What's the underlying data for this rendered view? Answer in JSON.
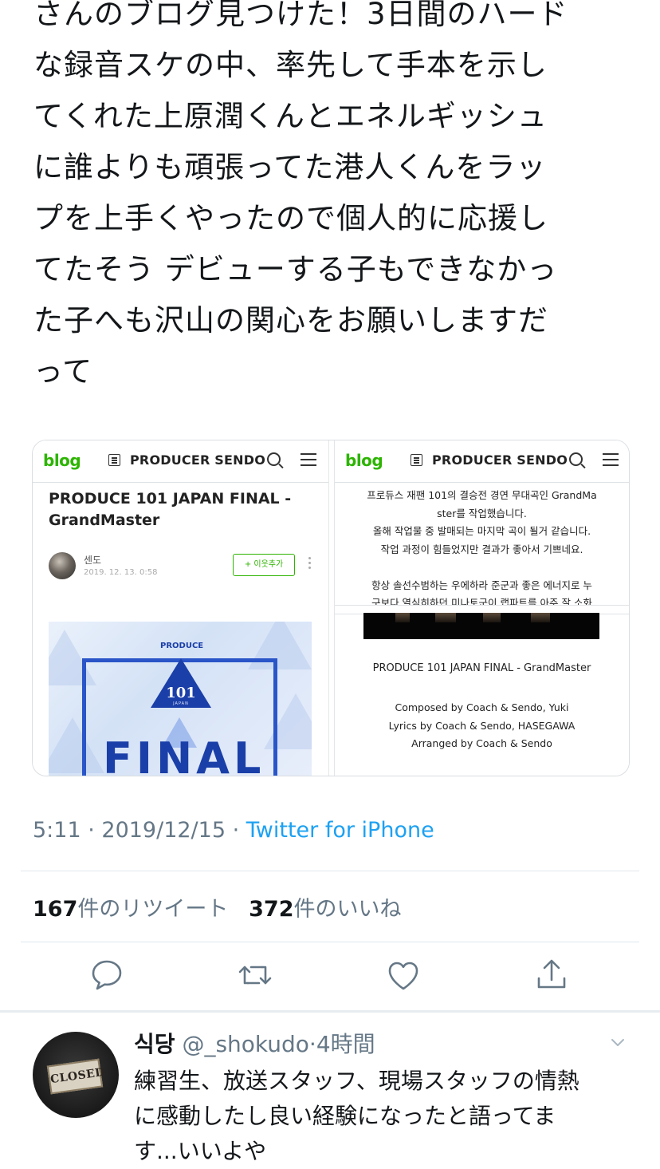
{
  "tweet": {
    "text_lines": [
      "さんのブログ見つけた！3日間のハード",
      "な録音スケの中、率先して手本を示し",
      "てくれた上原潤くんとエネルギッシュ",
      "に誰よりも頑張ってた港人くんをラッ",
      "プを上手くやったので個人的に応援し",
      "てたそう デビューする子もできなかっ",
      "た子へも沢山の関心をお願いしますだ",
      "って"
    ],
    "time": "5:11",
    "date": "2019/12/15",
    "separator": " · ",
    "source": "Twitter for iPhone",
    "retweet_count": "167",
    "retweet_label": "件のリツイート",
    "like_count": "372",
    "like_label": "件のいいね"
  },
  "media_left": {
    "logo": "blog",
    "blog_name": "PRODUCER SENDO",
    "post_title": "PRODUCE 101 JAPAN FINAL - GrandMaster",
    "author": "센도",
    "post_date": "2019. 12. 13. 0:58",
    "follow_label": "+ 이웃추가",
    "poster_logo": "PRODUCE",
    "poster_num": "101",
    "poster_sub": "JAPAN",
    "poster_word": "FINAL"
  },
  "media_right": {
    "logo": "blog",
    "blog_name": "PRODUCER SENDO",
    "kr_lines": [
      "프로듀스 재팬 101의 결승전 경연 무대곡인 GrandMa",
      "ster를 작업했습니다.",
      "올해 작업물 중 발매되는 마지막 곡이 될거 같습니다.",
      "작업 과정이 힘들었지만 결과가 좋아서 기쁘네요.",
      "",
      "항상 솔선수범하는 우에하라 준군과 좋은 에너지로 누",
      "구보다 열심히하던 미나토군이 랩파트를 아주 잘 소화"
    ],
    "credit_title": "PRODUCE 101 JAPAN FINAL - GrandMaster",
    "credits": [
      "Composed by Coach & Sendo, Yuki",
      "Lyrics by Coach & Sendo, HASEGAWA",
      "Arranged by Coach & Sendo"
    ]
  },
  "actions": {
    "reply_icon": "comment-icon",
    "retweet_icon": "retweet-icon",
    "like_icon": "heart-icon",
    "share_icon": "share-icon",
    "color": "#657786"
  },
  "reply": {
    "name": "식당",
    "handle": "@_shokudo",
    "dot": "·",
    "time": "4時間",
    "avatar_sign": "CLOSED",
    "text_lines": [
      "練習生、放送スタッフ、現場スタッフの情熱",
      "に感動したし良い経験になったと語ってま",
      "す...いいよや"
    ]
  },
  "colors": {
    "link": "#1da1f2",
    "muted": "#657786",
    "text": "#14171a",
    "naver_green": "#2db400"
  }
}
